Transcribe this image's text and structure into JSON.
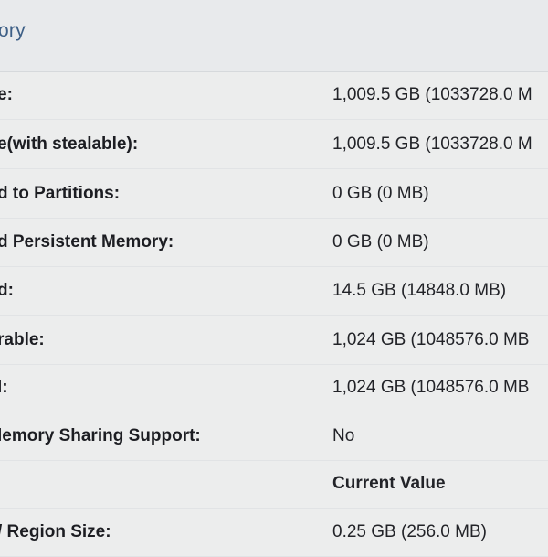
{
  "panel": {
    "title": "ory"
  },
  "rows": [
    {
      "label": "e:",
      "value": "1,009.5 GB (1033728.0 M"
    },
    {
      "label": "e(with stealable):",
      "value": "1,009.5 GB (1033728.0 M"
    },
    {
      "label": "d to Partitions:",
      "value": "0 GB (0 MB)"
    },
    {
      "label": "d Persistent Memory:",
      "value": "0 GB (0 MB)"
    },
    {
      "label": "d:",
      "value": "14.5 GB (14848.0 MB)"
    },
    {
      "label": "rable:",
      "value": "1,024 GB (1048576.0 MB"
    },
    {
      "label": "l:",
      "value": "1,024 GB (1048576.0 MB"
    },
    {
      "label": "lemory Sharing Support:",
      "value": "No"
    },
    {
      "label": "",
      "value": "Current Value"
    },
    {
      "label": "/ Region Size:",
      "value": "0.25 GB (256.0 MB)"
    }
  ]
}
